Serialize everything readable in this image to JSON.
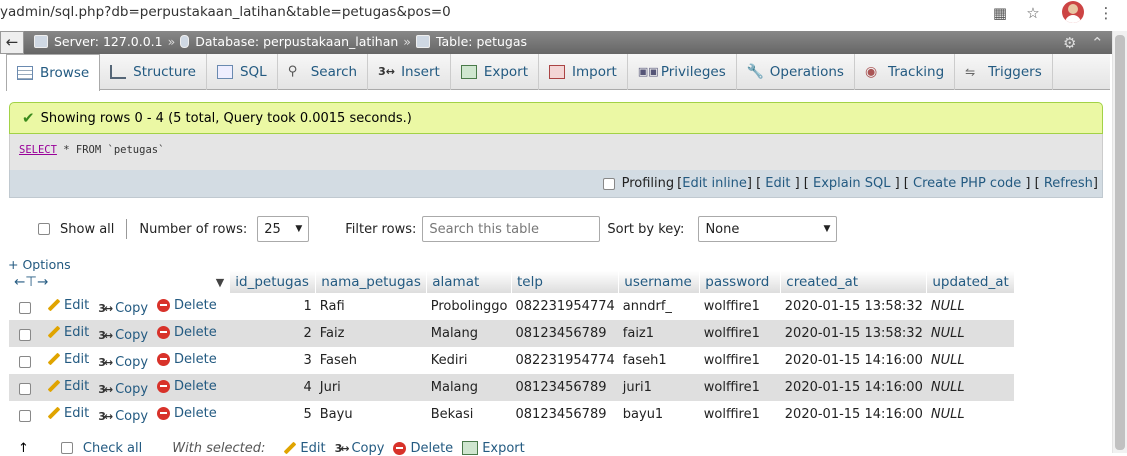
{
  "browser": {
    "url": "yadmin/sql.php?db=perpustakaan_latihan&table=petugas&pos=0"
  },
  "breadcrumb": {
    "server": "Server: 127.0.0.1",
    "database": "Database: perpustakaan_latihan",
    "table": "Table: petugas",
    "separator": "»"
  },
  "tabs": [
    {
      "label": "Browse"
    },
    {
      "label": "Structure"
    },
    {
      "label": "SQL"
    },
    {
      "label": "Search"
    },
    {
      "label": "Insert"
    },
    {
      "label": "Export"
    },
    {
      "label": "Import"
    },
    {
      "label": "Privileges"
    },
    {
      "label": "Operations"
    },
    {
      "label": "Tracking"
    },
    {
      "label": "Triggers"
    }
  ],
  "notice": {
    "text": "Showing rows 0 - 4 (5 total, Query took 0.0015 seconds.)"
  },
  "sql": {
    "keyword1": "SELECT",
    "rest": "* FROM `petugas`"
  },
  "tools": {
    "profiling": "Profiling",
    "edit_inline": "Edit inline",
    "edit": "Edit",
    "explain": "Explain SQL",
    "create_php": "Create PHP code",
    "refresh": "Refresh"
  },
  "nav": {
    "show_all": "Show all",
    "rows_label": "Number of rows:",
    "rows_value": "25",
    "filter_label": "Filter rows:",
    "filter_placeholder": "Search this table",
    "sort_label": "Sort by key:",
    "sort_value": "None"
  },
  "options_link": "+ Options",
  "columns": [
    "id_petugas",
    "nama_petugas",
    "alamat",
    "telp",
    "username",
    "password",
    "created_at",
    "updated_at"
  ],
  "actions": {
    "edit": "Edit",
    "copy": "Copy",
    "delete": "Delete"
  },
  "rows": [
    {
      "id": "1",
      "nama": "Rafi",
      "alamat": "Probolinggo",
      "telp": "082231954774",
      "username": "anndrf_",
      "password": "wolffire1",
      "created": "2020-01-15 13:58:32",
      "updated": "NULL"
    },
    {
      "id": "2",
      "nama": "Faiz",
      "alamat": "Malang",
      "telp": "08123456789",
      "username": "faiz1",
      "password": "wolffire1",
      "created": "2020-01-15 13:58:32",
      "updated": "NULL"
    },
    {
      "id": "3",
      "nama": "Faseh",
      "alamat": "Kediri",
      "telp": "082231954774",
      "username": "faseh1",
      "password": "wolffire1",
      "created": "2020-01-15 14:16:00",
      "updated": "NULL"
    },
    {
      "id": "4",
      "nama": "Juri",
      "alamat": "Malang",
      "telp": "08123456789",
      "username": "juri1",
      "password": "wolffire1",
      "created": "2020-01-15 14:16:00",
      "updated": "NULL"
    },
    {
      "id": "5",
      "nama": "Bayu",
      "alamat": "Bekasi",
      "telp": "08123456789",
      "username": "bayu1",
      "password": "wolffire1",
      "created": "2020-01-15 14:16:00",
      "updated": "NULL"
    }
  ],
  "bottom": {
    "check_all": "Check all",
    "with_selected": "With selected:",
    "edit": "Edit",
    "copy": "Copy",
    "delete": "Delete",
    "export": "Export"
  },
  "colors": {
    "link": "#235a81",
    "notice_bg": "#ebf8a4",
    "row_alt": "#dfdfdf"
  }
}
